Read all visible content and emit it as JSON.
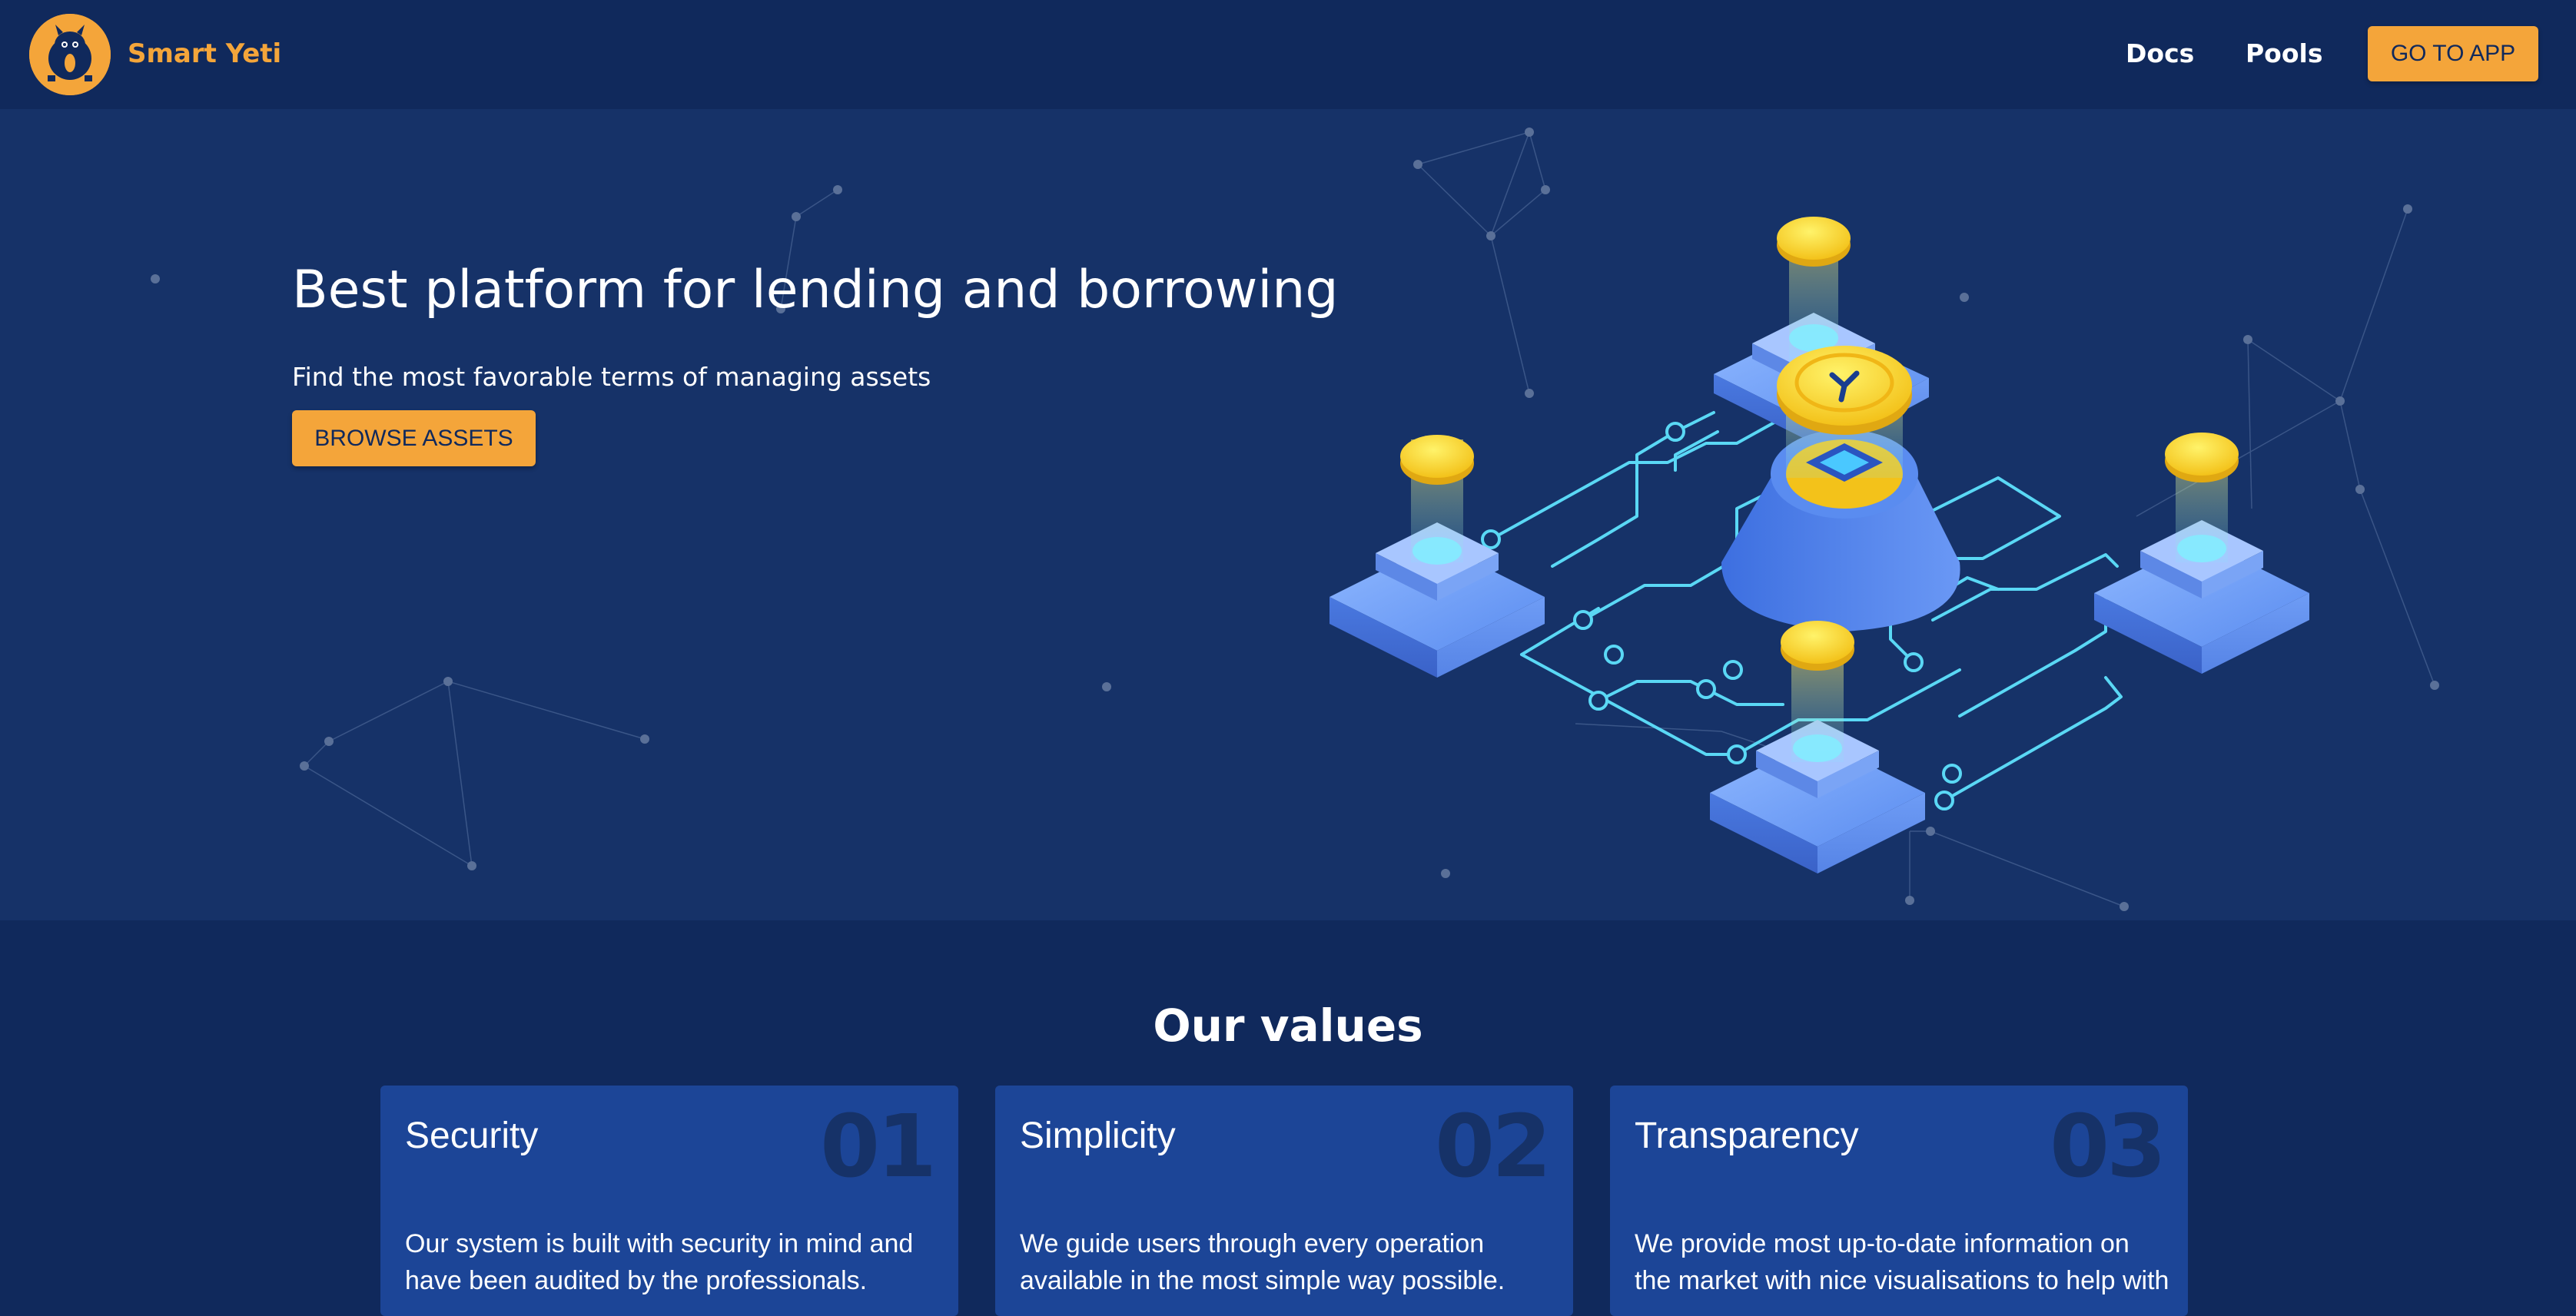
{
  "navbar": {
    "brand": "Smart Yeti",
    "logo_icon": "yeti-logo-icon",
    "links": [
      {
        "label": "Docs"
      },
      {
        "label": "Pools"
      }
    ],
    "cta_label": "GO TO APP"
  },
  "hero": {
    "title": "Best platform for lending and borrowing",
    "subtitle": "Find the most favorable terms of managing assets",
    "button_label": "BROWSE ASSETS",
    "illustration_icon": "isometric-blockchain-illustration"
  },
  "values": {
    "title": "Our values",
    "cards": [
      {
        "title": "Security",
        "number": "01",
        "text": "Our system is built with security in mind and have been audited by the professionals."
      },
      {
        "title": "Simplicity",
        "number": "02",
        "text": "We guide users through every operation available in the most simple way possible."
      },
      {
        "title": "Transparency",
        "number": "03",
        "text": "We provide most up-to-date information on the market with nice visualisations to help with"
      }
    ]
  },
  "colors": {
    "accent": "#f4a53a",
    "navbar_bg": "#10295c",
    "hero_bg": "#163268",
    "card_bg": "#1c4597",
    "circuit": "#5ad8f5",
    "coin": "#ffd83a"
  }
}
